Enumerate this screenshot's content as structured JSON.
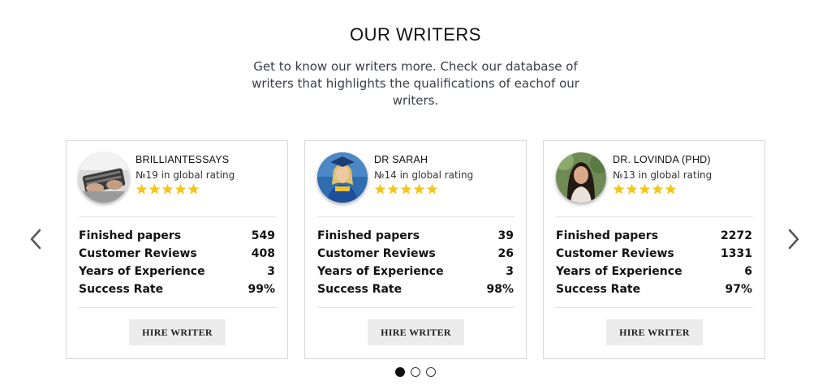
{
  "section": {
    "title": "OUR WRITERS",
    "description": "Get to know our writers more. Check our database of writers that highlights the qualifications of eachof our writers."
  },
  "nav": {
    "prev_icon": "chevron-left-icon",
    "next_icon": "chevron-right-icon"
  },
  "stat_labels": {
    "finished": "Finished papers",
    "reviews": "Customer Reviews",
    "experience": "Years of Experience",
    "success": "Success Rate"
  },
  "writers": [
    {
      "name": "BRILLIANTESSAYS",
      "rating": "№19 in global rating",
      "stars": 5,
      "finished": "549",
      "reviews": "408",
      "experience": "3",
      "success": "99%",
      "hire_label": "HIRE WRITER"
    },
    {
      "name": "DR SARAH",
      "rating": "№14 in global rating",
      "stars": 5,
      "finished": "39",
      "reviews": "26",
      "experience": "3",
      "success": "98%",
      "hire_label": "HIRE WRITER"
    },
    {
      "name": "DR. LOVINDA (PHD)",
      "rating": "№13 in global rating",
      "stars": 5,
      "finished": "2272",
      "reviews": "1331",
      "experience": "6",
      "success": "97%",
      "hire_label": "HIRE WRITER"
    }
  ],
  "pagination": {
    "pages": 3,
    "active": 1
  },
  "colors": {
    "star": "#f5c518",
    "card_border": "#dadada",
    "button_bg": "#ececec"
  }
}
